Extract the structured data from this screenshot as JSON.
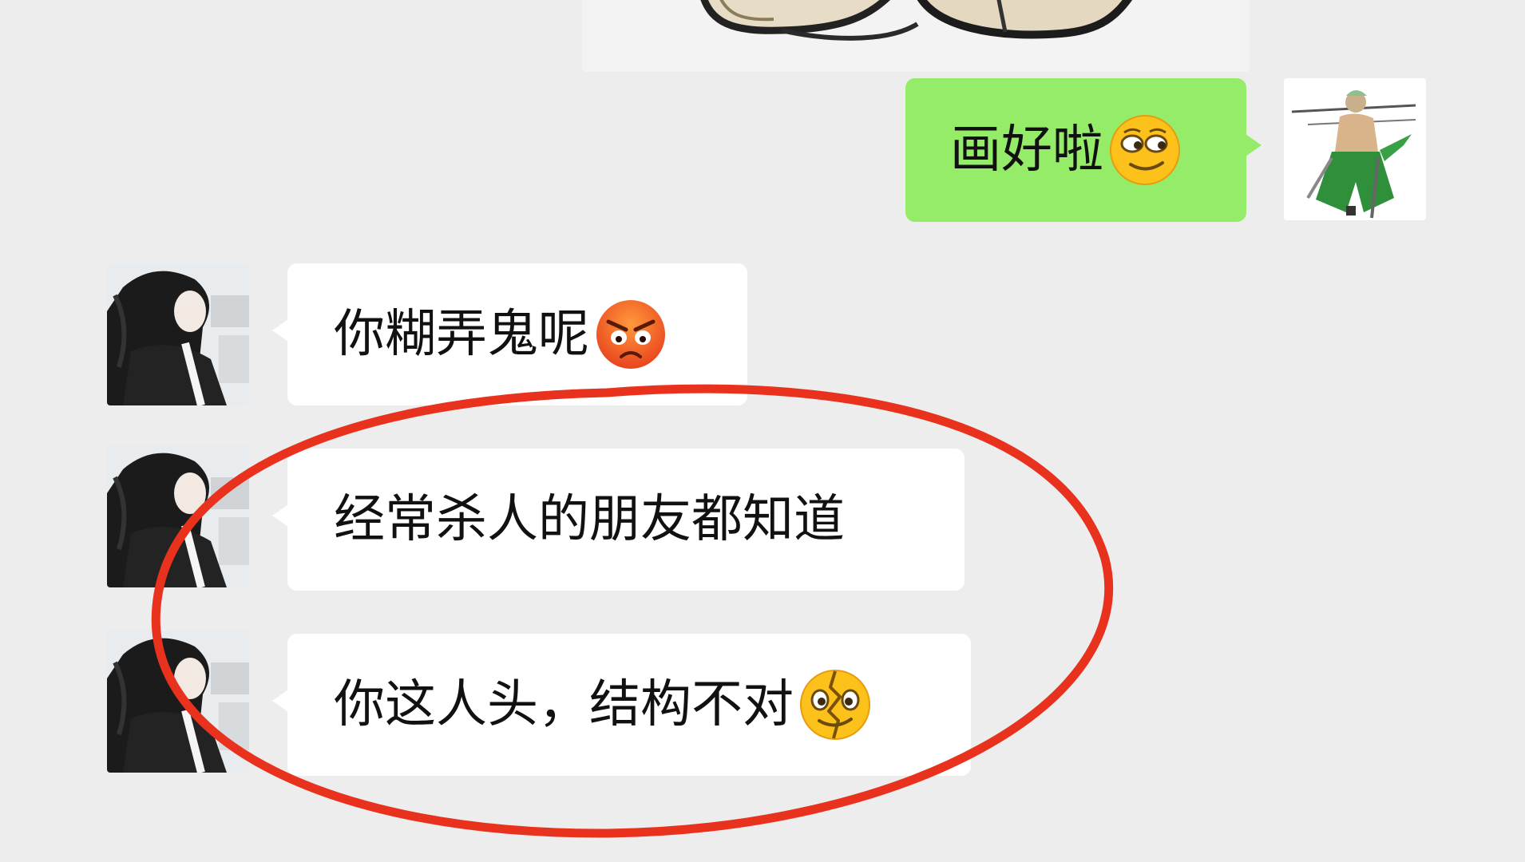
{
  "messages": [
    {
      "side": "out",
      "text": "画好啦",
      "emoji": "smirk-emoji"
    },
    {
      "side": "in",
      "text": "你糊弄鬼呢",
      "emoji": "angry-emoji"
    },
    {
      "side": "in",
      "text": "经常杀人的朋友都知道",
      "emoji": ""
    },
    {
      "side": "in",
      "text": "你这人头，结构不对",
      "emoji": "cracked-face-emoji"
    }
  ],
  "colors": {
    "background": "#ededed",
    "outgoing_bubble": "#95ec69",
    "incoming_bubble": "#ffffff",
    "annotation_circle": "#e8321e"
  }
}
